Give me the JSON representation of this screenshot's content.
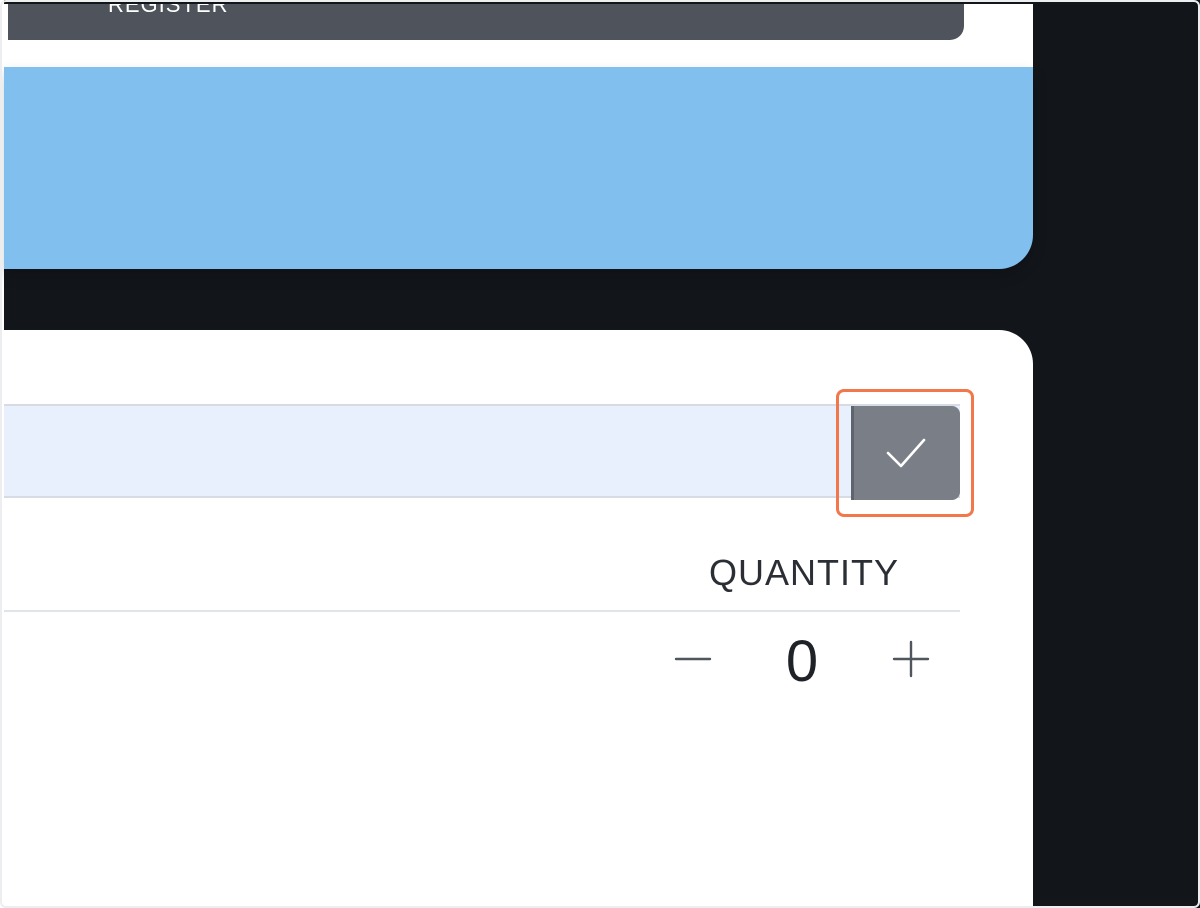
{
  "top_button": {
    "label": "REGISTER"
  },
  "entry": {
    "value": "",
    "placeholder": ""
  },
  "confirm_button": {
    "icon": "checkmark-icon"
  },
  "table": {
    "quantity_header": "QUANTITY"
  },
  "stepper": {
    "decrement_symbol": "−",
    "value": "0",
    "increment_symbol": "+"
  },
  "colors": {
    "blue_panel": "#80bfee",
    "dark_background": "#12151a",
    "highlight": "#f2784b",
    "confirm_button": "#7a7e87",
    "entry_row": "#e8effd"
  }
}
